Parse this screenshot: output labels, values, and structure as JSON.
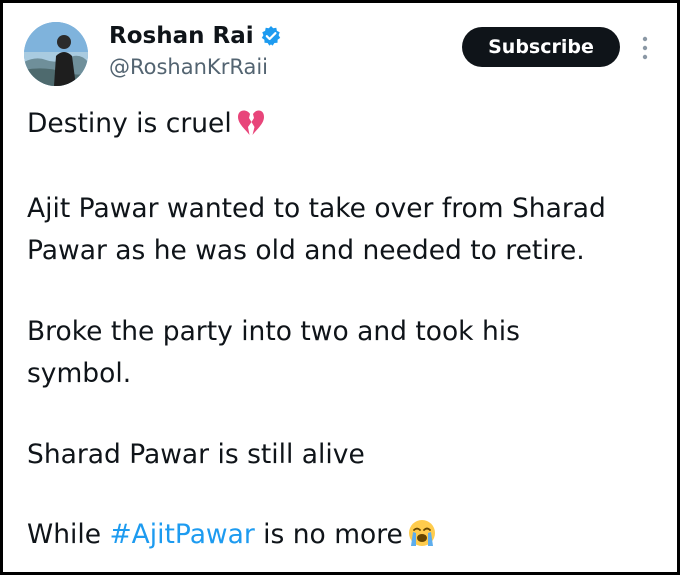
{
  "author": {
    "display_name": "Roshan Rai",
    "handle": "@RoshanKrRaii",
    "verified": true,
    "verified_color": "#1d9bf0"
  },
  "actions": {
    "subscribe_label": "Subscribe",
    "more_icon": "more-vertical-icon"
  },
  "tweet": {
    "line1": "Destiny is cruel",
    "line1_emoji": "broken-heart-icon",
    "p2_line1": "Ajit Pawar wanted to take over from Sharad",
    "p2_line2": "Pawar as he was old and needed to retire.",
    "p3_line1": "Broke the party into two and took his",
    "p3_line2": "symbol.",
    "p4": "Sharad Pawar is still alive",
    "p5_before": "While ",
    "p5_hashtag": "#AjitPawar",
    "p5_after": " is no more",
    "p5_emoji": "loudly-crying-face-icon"
  },
  "colors": {
    "text": "#0f1419",
    "secondary": "#536471",
    "link": "#1d9bf0",
    "button_bg": "#0f1419",
    "border": "#000000"
  }
}
